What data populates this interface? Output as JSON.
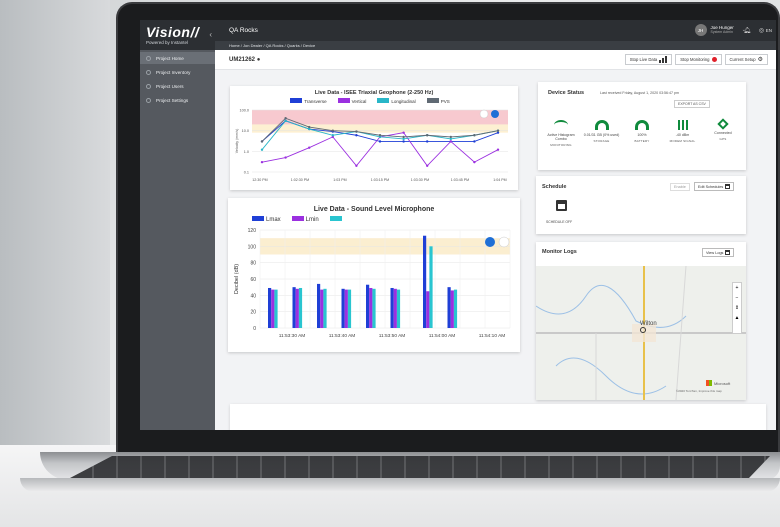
{
  "app": {
    "brand": "Vision//",
    "powered_by": "Powered by Instantel",
    "page_title": "QA Rocks",
    "breadcrumb": "Home / Jon Dealer / QA Rocks / Quarks / Device"
  },
  "user": {
    "initials": "JH",
    "name": "Joe Hunger",
    "role": "System Admin"
  },
  "topbar_lang": "EN",
  "sidebar": {
    "items": [
      {
        "label": "Project Home",
        "active": true
      },
      {
        "label": "Project Inventory",
        "active": false
      },
      {
        "label": "Project Users",
        "active": false
      },
      {
        "label": "Project Settings",
        "active": false
      }
    ]
  },
  "device": {
    "id": "UM21262"
  },
  "toolbar": {
    "stop_live_label": "Stop Live Data",
    "stop_monitoring_label": "Stop Monitoring",
    "current_setup_label": "Current Setup"
  },
  "geophone_chart": {
    "title": "Live Data - ISEE Triaxial Geophone (2-250 Hz)",
    "legend": [
      {
        "name": "Transverse",
        "color": "#1f3fd6"
      },
      {
        "name": "Vertical",
        "color": "#9b30e0"
      },
      {
        "name": "Longitudinal",
        "color": "#29b6c8"
      },
      {
        "name": "PVS",
        "color": "#606a74"
      }
    ],
    "ylabel": "Velocity (mm/s)",
    "ytick_labels": [
      "100.0",
      "10.0",
      "1.0",
      "0.1"
    ],
    "xtick_labels": [
      "12:30 PM",
      "1:02:30 PM",
      "1:03 PM",
      "1:03:15 PM",
      "1:03:30 PM",
      "1:03:45 PM",
      "1:04 PM"
    ]
  },
  "sound_chart": {
    "title": "Live Data - Sound Level Microphone",
    "legend": [
      {
        "name": "Lmax",
        "color": "#1f3fd6"
      },
      {
        "name": "Lmin",
        "color": "#9b30e0"
      },
      {
        "name": "",
        "color": "#29c5d0"
      }
    ],
    "ylabel": "Decibel (dB)",
    "ytick_labels": [
      "120",
      "100",
      "80",
      "60",
      "40",
      "20",
      "0"
    ],
    "xtick_labels": [
      "11:53:30 AM",
      "11:53:40 AM",
      "11:53:50 AM",
      "11:54:00 AM",
      "11:54:10 AM"
    ]
  },
  "chart_data": [
    {
      "type": "line",
      "title": "Live Data - ISEE Triaxial Geophone (2-250 Hz)",
      "ylabel": "Velocity (mm/s)",
      "ylog": true,
      "ylim": [
        0.1,
        100
      ],
      "x": [
        0,
        1,
        2,
        3,
        4,
        5,
        6,
        7,
        8,
        9,
        10
      ],
      "series": [
        {
          "name": "Transverse",
          "values": [
            3,
            30,
            12,
            9,
            6,
            3,
            3,
            3,
            3,
            3,
            8
          ]
        },
        {
          "name": "Vertical",
          "values": [
            0.3,
            0.5,
            1.5,
            5,
            0.2,
            5,
            8,
            0.2,
            3,
            0.3,
            1.2
          ]
        },
        {
          "name": "Longitudinal",
          "values": [
            1.2,
            30,
            12,
            6,
            9,
            5,
            4,
            6,
            4,
            6,
            10
          ]
        },
        {
          "name": "PVS",
          "values": [
            3,
            40,
            15,
            10,
            9,
            6,
            5,
            6,
            5,
            6,
            10
          ]
        }
      ]
    },
    {
      "type": "bar",
      "title": "Live Data - Sound Level Microphone",
      "ylabel": "Decibel (dB)",
      "ylim": [
        0,
        120
      ],
      "categories": [
        "1",
        "2",
        "3",
        "4",
        "5",
        "6",
        "7",
        "8"
      ],
      "series": [
        {
          "name": "Lmax",
          "values": [
            49,
            50,
            54,
            48,
            53,
            49,
            113,
            50
          ]
        },
        {
          "name": "Lmin",
          "values": [
            47,
            48,
            47,
            47,
            49,
            48,
            45,
            46
          ]
        },
        {
          "name": "",
          "values": [
            47,
            49,
            48,
            47,
            48,
            47,
            100,
            47
          ]
        }
      ]
    }
  ],
  "device_status": {
    "title": "Device Status",
    "last_received": "Last received Friday, August 1, 2020 03:56:47 pm",
    "export_label": "EXPORT AS CSV",
    "items": [
      {
        "value": "Active Histogram Combo",
        "caption": "MONITORING",
        "icon": "antenna-icon"
      },
      {
        "value": "0.01/31 GB (0% used)",
        "caption": "STORAGE",
        "icon": "storage-gauge-icon"
      },
      {
        "value": "100%",
        "caption": "BATTERY",
        "icon": "battery-gauge-icon"
      },
      {
        "value": "-40 dBm",
        "caption": "MODEM SIGNAL",
        "icon": "signal-icon"
      },
      {
        "value": "Connected",
        "caption": "GPS",
        "icon": "gps-icon"
      }
    ]
  },
  "schedule": {
    "title": "Schedule",
    "enable_label": "Enable",
    "edit_label": "Edit Schedules",
    "status": "SCHEDULE OFF"
  },
  "monitor_logs": {
    "title": "Monitor Logs",
    "view_label": "View Logs",
    "map_town": "Wilton",
    "map_attribution": "©2020 TomTom, Improve this map",
    "map_brand": "Microsoft"
  },
  "colors": {
    "accent": "#1f3fd6",
    "stop_red": "#e0202a",
    "status_green": "#0f8a3c",
    "dark": "#2c2f33"
  }
}
